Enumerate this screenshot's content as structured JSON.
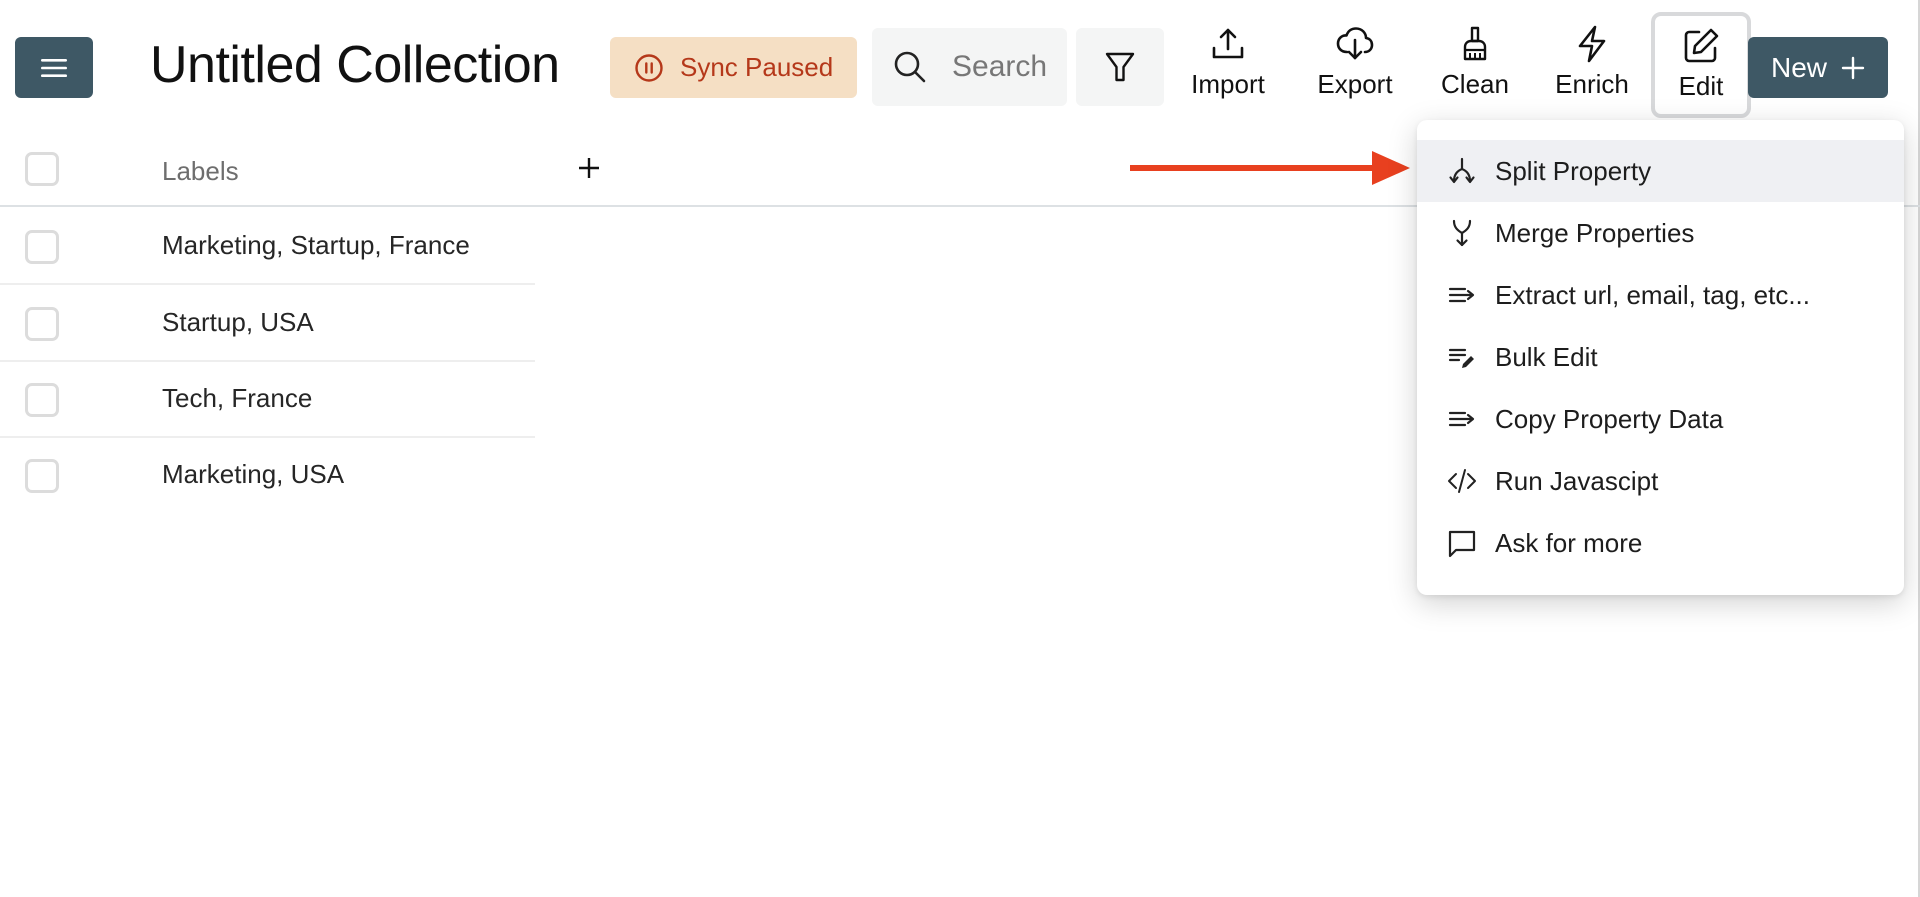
{
  "header": {
    "menu_icon": "hamburger-menu-icon",
    "title": "Untitled Collection",
    "sync_status": {
      "label": "Sync Paused",
      "icon": "pause-circle-icon",
      "color": "#b5381a",
      "background": "#f5dfc4"
    },
    "search": {
      "placeholder": "Search",
      "visible_text": "Searc",
      "value": ""
    },
    "filter_icon": "filter-icon",
    "tools": [
      {
        "label": "Import",
        "icon": "upload-icon"
      },
      {
        "label": "Export",
        "icon": "cloud-download-icon"
      },
      {
        "label": "Clean",
        "icon": "broom-icon"
      },
      {
        "label": "Enrich",
        "icon": "lightning-icon"
      },
      {
        "label": "Edit",
        "icon": "edit-square-icon",
        "active": true
      }
    ],
    "new_button": {
      "label": "New",
      "icon": "plus-icon"
    },
    "brand_color": "#3e5865"
  },
  "table": {
    "columns": [
      {
        "label": "Labels"
      }
    ],
    "add_column_icon": "plus-icon",
    "rows": [
      {
        "labels": "Marketing, Startup, France",
        "checked": false
      },
      {
        "labels": "Startup, USA",
        "checked": false
      },
      {
        "labels": "Tech, France",
        "checked": false
      },
      {
        "labels": "Marketing, USA",
        "checked": false
      }
    ]
  },
  "annotation": {
    "type": "arrow",
    "color": "#e8401f",
    "points_to": "Split Property"
  },
  "edit_menu": {
    "items": [
      {
        "label": "Split Property",
        "icon": "split-icon",
        "highlighted": true
      },
      {
        "label": "Merge Properties",
        "icon": "merge-icon"
      },
      {
        "label": "Extract url, email, tag, etc...",
        "icon": "extract-icon"
      },
      {
        "label": "Bulk Edit",
        "icon": "bulk-edit-icon"
      },
      {
        "label": "Copy Property Data",
        "icon": "copy-data-icon"
      },
      {
        "label": "Run Javascipt",
        "icon": "code-icon"
      },
      {
        "label": "Ask for more",
        "icon": "chat-bubble-icon"
      }
    ]
  }
}
